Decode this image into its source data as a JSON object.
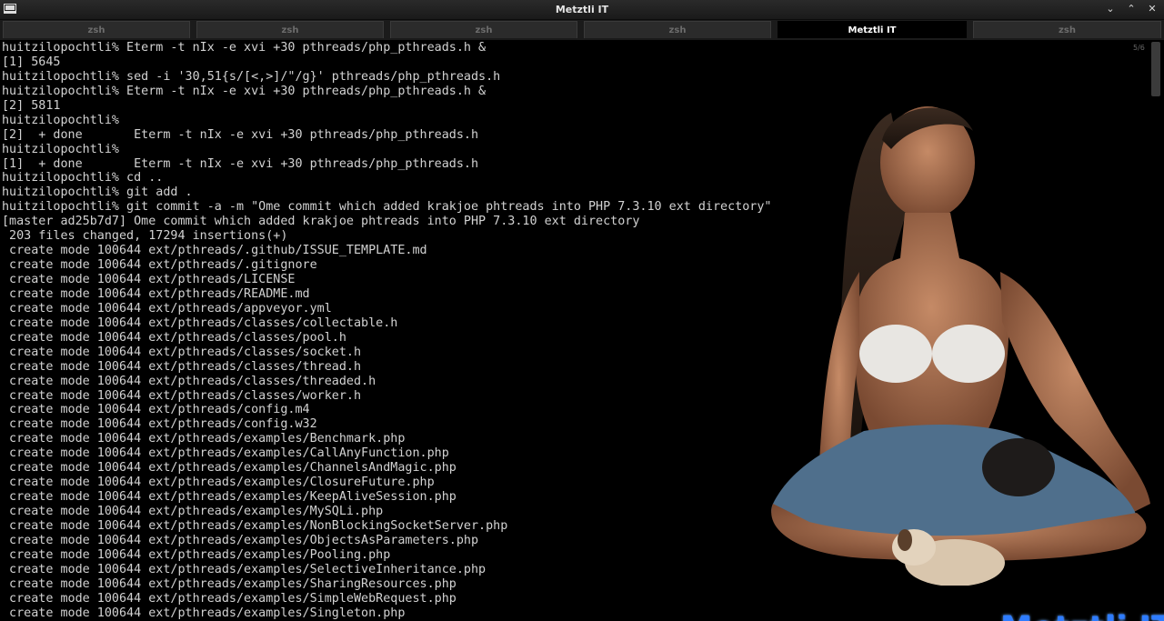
{
  "window": {
    "title": "Metztli IT",
    "app_icon": "terminal-icon",
    "controls": {
      "minimize": "⌄",
      "maximize": "⌃",
      "close": "✕"
    }
  },
  "tabs": [
    {
      "label": "zsh",
      "active": false
    },
    {
      "label": "zsh",
      "active": false
    },
    {
      "label": "zsh",
      "active": false
    },
    {
      "label": "zsh",
      "active": false
    },
    {
      "label": "Metztli IT",
      "active": true
    },
    {
      "label": "zsh",
      "active": false
    }
  ],
  "terminal": {
    "scroll_counter": "5/6",
    "lines": [
      "huitzilopochtli% Eterm -t nIx -e xvi +30 pthreads/php_pthreads.h &",
      "[1] 5645",
      "huitzilopochtli% sed -i '30,51{s/[<,>]/\"/g}' pthreads/php_pthreads.h",
      "huitzilopochtli% Eterm -t nIx -e xvi +30 pthreads/php_pthreads.h &",
      "[2] 5811",
      "huitzilopochtli%",
      "[2]  + done       Eterm -t nIx -e xvi +30 pthreads/php_pthreads.h",
      "huitzilopochtli%",
      "[1]  + done       Eterm -t nIx -e xvi +30 pthreads/php_pthreads.h",
      "huitzilopochtli% cd ..",
      "huitzilopochtli% git add .",
      "huitzilopochtli% git commit -a -m \"Ome commit which added krakjoe phtreads into PHP 7.3.10 ext directory\"",
      "[master ad25b7d7] Ome commit which added krakjoe phtreads into PHP 7.3.10 ext directory",
      " 203 files changed, 17294 insertions(+)",
      " create mode 100644 ext/pthreads/.github/ISSUE_TEMPLATE.md",
      " create mode 100644 ext/pthreads/.gitignore",
      " create mode 100644 ext/pthreads/LICENSE",
      " create mode 100644 ext/pthreads/README.md",
      " create mode 100644 ext/pthreads/appveyor.yml",
      " create mode 100644 ext/pthreads/classes/collectable.h",
      " create mode 100644 ext/pthreads/classes/pool.h",
      " create mode 100644 ext/pthreads/classes/socket.h",
      " create mode 100644 ext/pthreads/classes/thread.h",
      " create mode 100644 ext/pthreads/classes/threaded.h",
      " create mode 100644 ext/pthreads/classes/worker.h",
      " create mode 100644 ext/pthreads/config.m4",
      " create mode 100644 ext/pthreads/config.w32",
      " create mode 100644 ext/pthreads/examples/Benchmark.php",
      " create mode 100644 ext/pthreads/examples/CallAnyFunction.php",
      " create mode 100644 ext/pthreads/examples/ChannelsAndMagic.php",
      " create mode 100644 ext/pthreads/examples/ClosureFuture.php",
      " create mode 100644 ext/pthreads/examples/KeepAliveSession.php",
      " create mode 100644 ext/pthreads/examples/MySQLi.php",
      " create mode 100644 ext/pthreads/examples/NonBlockingSocketServer.php",
      " create mode 100644 ext/pthreads/examples/ObjectsAsParameters.php",
      " create mode 100644 ext/pthreads/examples/Pooling.php",
      " create mode 100644 ext/pthreads/examples/SelectiveInheritance.php",
      " create mode 100644 ext/pthreads/examples/SharingResources.php",
      " create mode 100644 ext/pthreads/examples/SimpleWebRequest.php",
      " create mode 100644 ext/pthreads/examples/Singleton.php"
    ]
  },
  "branding": {
    "logo_text": "Metztli IT",
    "logo_color": "#2e7cff"
  }
}
